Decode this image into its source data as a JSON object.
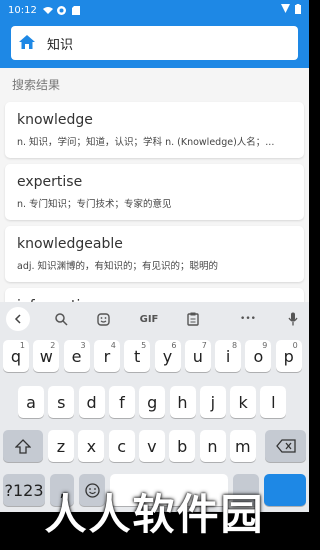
{
  "statusbar": {
    "time": "10:12"
  },
  "search": {
    "value": "知识"
  },
  "results": {
    "title": "搜索结果",
    "items": [
      {
        "word": "knowledge",
        "definition": "n. 知识，学问；知道，认识；学科 n. (Knowledge)人名；..."
      },
      {
        "word": "expertise",
        "definition": "n. 专门知识；专门技术；专家的意见"
      },
      {
        "word": "knowledgeable",
        "definition": "adj. 知识渊博的，有知识的；有见识的；聪明的"
      },
      {
        "word": "information",
        "definition": ""
      }
    ]
  },
  "keyboard": {
    "toolbar": {
      "gif": "GIF",
      "more": "•••"
    },
    "row1": [
      {
        "k": "q",
        "n": "1"
      },
      {
        "k": "w",
        "n": "2"
      },
      {
        "k": "e",
        "n": "3"
      },
      {
        "k": "r",
        "n": "4"
      },
      {
        "k": "t",
        "n": "5"
      },
      {
        "k": "y",
        "n": "6"
      },
      {
        "k": "u",
        "n": "7"
      },
      {
        "k": "i",
        "n": "8"
      },
      {
        "k": "o",
        "n": "9"
      },
      {
        "k": "p",
        "n": "0"
      }
    ],
    "row2": [
      "a",
      "s",
      "d",
      "f",
      "g",
      "h",
      "j",
      "k",
      "l"
    ],
    "row3": [
      "z",
      "x",
      "c",
      "v",
      "b",
      "n",
      "m"
    ],
    "symbols_label": "?123",
    "comma_label": ","
  },
  "watermark": "人人软件园",
  "colors": {
    "primary": "#1e88e5",
    "background": "#f5f5f5",
    "keyboard": "#e8eaed"
  }
}
